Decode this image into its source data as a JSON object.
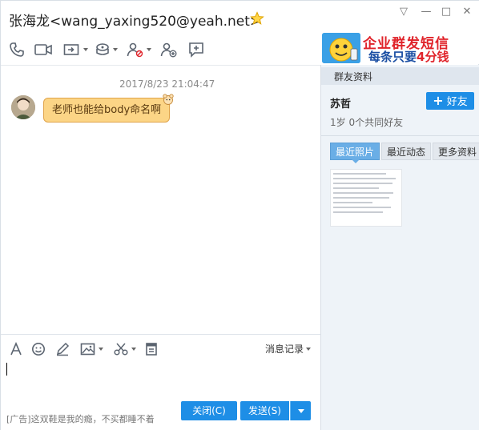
{
  "window": {
    "contact_title": "张海龙<wang_yaxing520@yeah.net>",
    "controls": {
      "menu": "▽",
      "minimize": "—",
      "maximize": "□",
      "close": "✕"
    }
  },
  "toolbar": {
    "items": [
      {
        "name": "voice-call",
        "icon": "phone-icon"
      },
      {
        "name": "video-call",
        "icon": "camera-icon"
      },
      {
        "name": "remote-desktop",
        "icon": "screen-share-icon"
      },
      {
        "name": "app-center",
        "icon": "app-icon"
      },
      {
        "name": "block-user",
        "icon": "user-block-icon"
      },
      {
        "name": "add-friend",
        "icon": "user-add-icon"
      },
      {
        "name": "add-message",
        "icon": "chat-add-icon"
      }
    ]
  },
  "ad_banner": {
    "line1": "企业群发短信",
    "line2_prefix": "每条只要",
    "line2_highlight": "4分钱"
  },
  "chat": {
    "time": "2017/8/23 21:04:47",
    "message": "老师也能给body命名啊"
  },
  "input_toolbar": {
    "history_label": "消息记录"
  },
  "bottom": {
    "ad_text": "[广告]这双鞋是我的瘾，不买都睡不着",
    "close_label": "关闭(C)",
    "send_label": "发送(S)"
  },
  "panel": {
    "header": "群友资料",
    "member_name": "苏哲",
    "add_friend_label": "好友",
    "meta": "1岁  0个共同好友",
    "tabs": [
      "最近照片",
      "最近动态",
      "更多资料"
    ]
  },
  "colors": {
    "accent": "#1e8ee6",
    "bubble": "#fcd586",
    "ad_red": "#e0242b",
    "ad_blue": "#1a4ea3",
    "panel_bg": "#eef3f8"
  }
}
